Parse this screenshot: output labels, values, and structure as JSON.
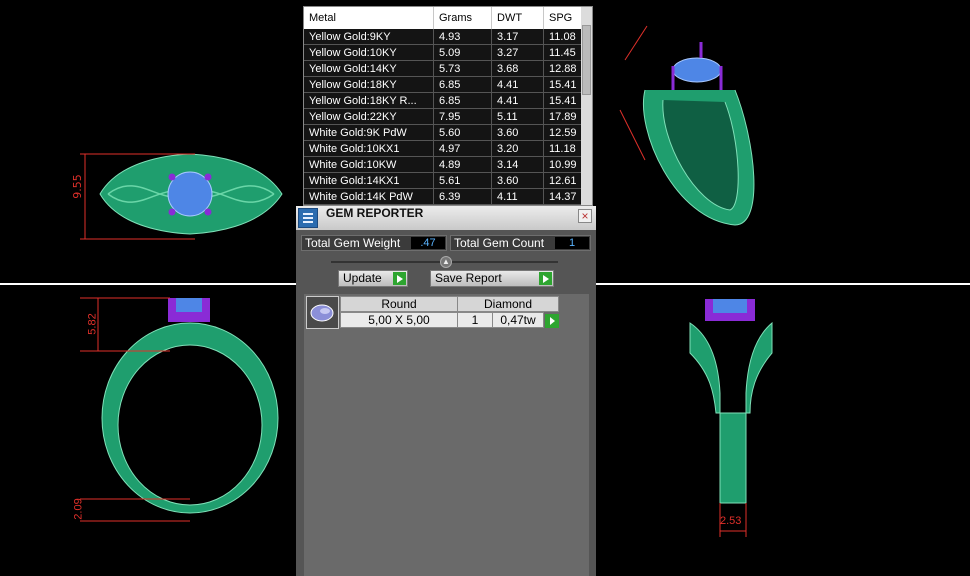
{
  "metal_table": {
    "headers": [
      "Metal",
      "Grams",
      "DWT",
      "SPG"
    ],
    "rows": [
      [
        "Yellow Gold:9KY",
        "4.93",
        "3.17",
        "11.08"
      ],
      [
        "Yellow Gold:10KY",
        "5.09",
        "3.27",
        "11.45"
      ],
      [
        "Yellow Gold:14KY",
        "5.73",
        "3.68",
        "12.88"
      ],
      [
        "Yellow Gold:18KY",
        "6.85",
        "4.41",
        "15.41"
      ],
      [
        "Yellow Gold:18KY R...",
        "6.85",
        "4.41",
        "15.41"
      ],
      [
        "Yellow Gold:22KY",
        "7.95",
        "5.11",
        "17.89"
      ],
      [
        "White Gold:9K PdW",
        "5.60",
        "3.60",
        "12.59"
      ],
      [
        "White Gold:10KX1",
        "4.97",
        "3.20",
        "11.18"
      ],
      [
        "White Gold:10KW",
        "4.89",
        "3.14",
        "10.99"
      ],
      [
        "White Gold:14KX1",
        "5.61",
        "3.60",
        "12.61"
      ],
      [
        "White Gold:14K PdW",
        "6.39",
        "4.11",
        "14.37"
      ]
    ]
  },
  "gem_reporter": {
    "title": "GEM REPORTER",
    "close_label": "×",
    "total_weight_label": "Total Gem Weight",
    "total_weight_value": ".47",
    "total_count_label": "Total Gem Count",
    "total_count_value": "1",
    "update_label": "Update",
    "save_report_label": "Save Report",
    "gems": [
      {
        "shape": "Round",
        "type": "Diamond",
        "size": "5,00 X 5,00",
        "count": "1",
        "weight": "0,47tw"
      }
    ]
  },
  "dimensions": {
    "top_view_width": "9.55",
    "front_view_height": "5.82",
    "front_view_band": "2.09",
    "side_view_band": "2.53"
  },
  "colors": {
    "ring_green": "#1f9e6e",
    "stone_blue": "#4e86e6",
    "prong_purple": "#8a2bd6",
    "dimension_red": "#e0302a",
    "panel_gray": "#555555",
    "accent_green": "#2ea530"
  },
  "icons": {
    "panel_icon": "report-list-icon",
    "close": "close-icon",
    "button_arrow": "play-arrow-icon",
    "gem_thumbnail": "round-gem-icon"
  }
}
